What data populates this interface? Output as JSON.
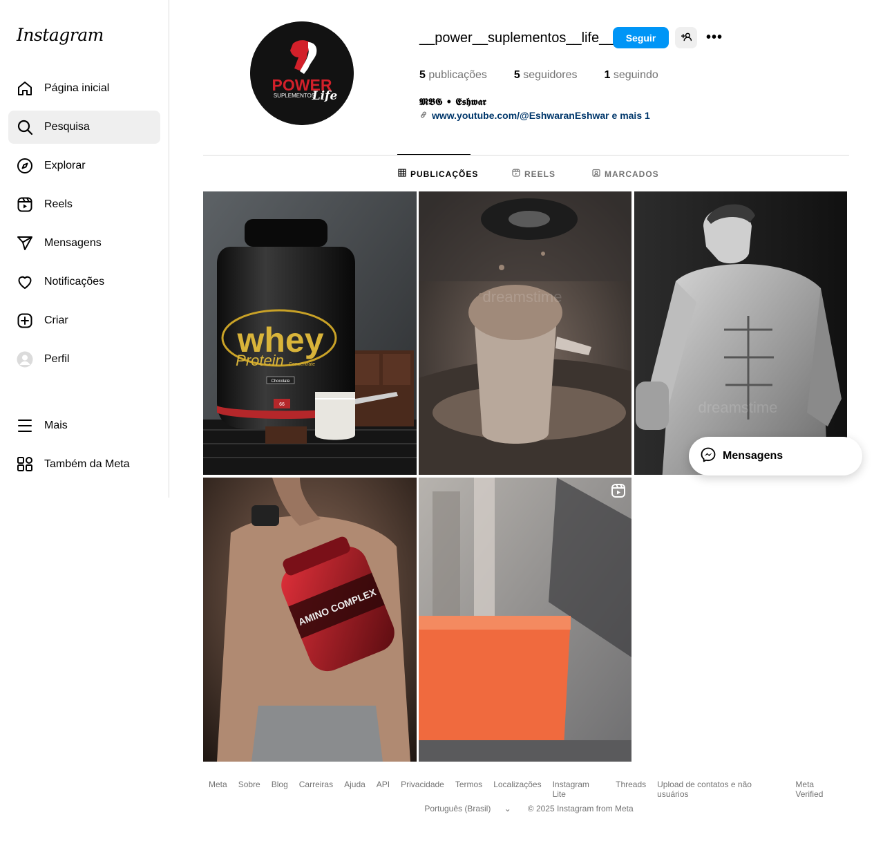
{
  "app": {
    "logo": "Instagram"
  },
  "sidebar": {
    "items": [
      {
        "label": "Página inicial",
        "icon": "home-icon"
      },
      {
        "label": "Pesquisa",
        "icon": "search-icon"
      },
      {
        "label": "Explorar",
        "icon": "compass-icon"
      },
      {
        "label": "Reels",
        "icon": "reels-icon"
      },
      {
        "label": "Mensagens",
        "icon": "send-icon"
      },
      {
        "label": "Notificações",
        "icon": "heart-icon"
      },
      {
        "label": "Criar",
        "icon": "plus-square-icon"
      },
      {
        "label": "Perfil",
        "icon": "avatar-icon"
      }
    ],
    "bottom": [
      {
        "label": "Mais",
        "icon": "menu-icon"
      },
      {
        "label": "Também da Meta",
        "icon": "meta-apps-icon"
      }
    ]
  },
  "profile": {
    "avatar_text_top": "POWER",
    "avatar_text_sub": "SUPLEMENTOS",
    "avatar_text_life": "Life",
    "username": "__power__suplementos__life__",
    "follow_label": "Seguir",
    "more_label": "•••",
    "stats": [
      {
        "count": "5",
        "label": "publicações"
      },
      {
        "count": "5",
        "label": "seguidores"
      },
      {
        "count": "1",
        "label": "seguindo"
      }
    ],
    "bio_name": "𝕸𝕭𝕲 • 𝕰𝖘𝖍𝖜𝖆𝖗",
    "bio_link": "www.youtube.com/@EshwaranEshwar e mais 1"
  },
  "tabs": [
    {
      "label": "PUBLICAÇÕES",
      "active": true
    },
    {
      "label": "REELS",
      "active": false
    },
    {
      "label": "MARCADOS",
      "active": false
    }
  ],
  "posts": [
    {
      "whey_word": "whey",
      "protein_word": "Protein",
      "concentrate": "Concentrate",
      "flavor": "Chocolate",
      "servings": "66"
    },
    {
      "watermark": "dreamstime"
    },
    {
      "watermark": "dreamstime"
    },
    {
      "label": "AMINO COMPLEX"
    },
    {
      "is_reel": true
    }
  ],
  "messages_pill": {
    "label": "Mensagens"
  },
  "footer": {
    "links": [
      "Meta",
      "Sobre",
      "Blog",
      "Carreiras",
      "Ajuda",
      "API",
      "Privacidade",
      "Termos",
      "Localizações",
      "Instagram Lite",
      "Threads",
      "Upload de contatos e não usuários",
      "Meta Verified"
    ],
    "language": "Português (Brasil)",
    "copyright": "© 2025 Instagram from Meta"
  },
  "colors": {
    "accent": "#0095f6",
    "link": "#00376b",
    "muted": "#737373",
    "border": "#dbdbdb"
  }
}
